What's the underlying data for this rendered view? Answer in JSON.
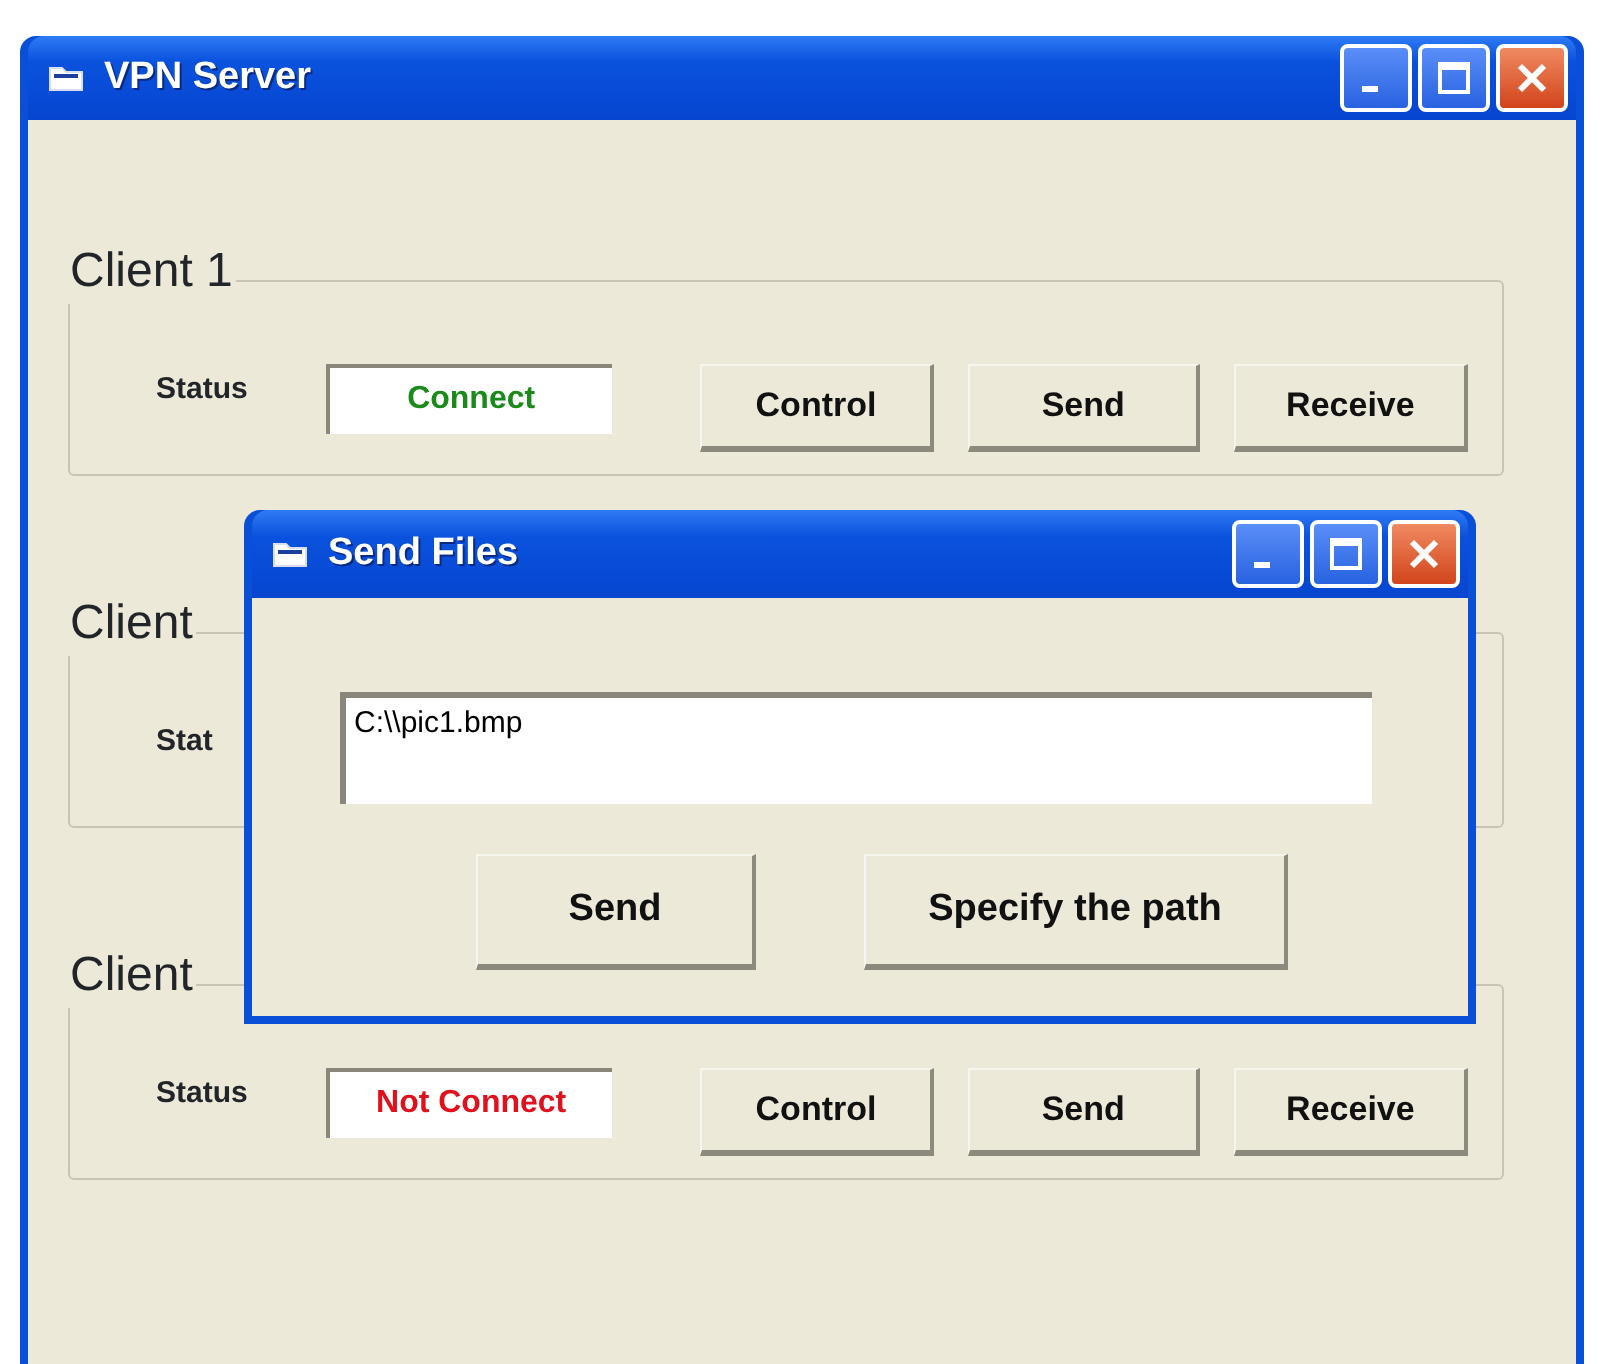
{
  "window": {
    "title": "VPN Server"
  },
  "clients": [
    {
      "name": "Client 1",
      "status_label": "Status",
      "status": {
        "text": "Connect",
        "connected": true
      },
      "buttons": [
        "Control",
        "Send",
        "Receive"
      ]
    },
    {
      "name": "Client",
      "status_label": "Stat"
    },
    {
      "name": "Client",
      "status_label": "Status",
      "status": {
        "text": "Not Connect",
        "connected": false
      },
      "buttons": [
        "Control",
        "Send",
        "Receive"
      ]
    }
  ],
  "dialog": {
    "title": "Send Files",
    "path": "C:\\\\pic1.bmp",
    "buttons": [
      "Send",
      "Specify the path"
    ]
  }
}
